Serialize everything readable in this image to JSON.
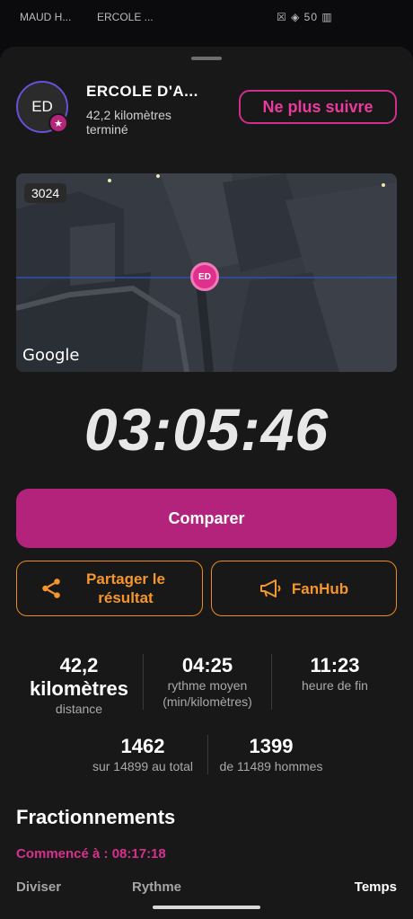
{
  "background": {
    "tab1": "MAUD H...",
    "tab2": "ERCOLE ...",
    "status": "☒ ◈ 50 ▥"
  },
  "header": {
    "avatar_initials": "ED",
    "name": "ERCOLE D'A...",
    "subtitle": "42,2 kilomètres terminé",
    "unfollow_label": "Ne plus suivre"
  },
  "map": {
    "badge": "3024",
    "marker_initials": "ED",
    "logo": "Google"
  },
  "timer": "03:05:46",
  "actions": {
    "compare_label": "Comparer",
    "share_label": "Partager le résultat",
    "fanhub_label": "FanHub"
  },
  "stats": {
    "distance": {
      "value": "42,2 kilomètres",
      "label": "distance"
    },
    "pace": {
      "value": "04:25",
      "label": "rythme moyen (min/kilomètres)"
    },
    "finish": {
      "value": "11:23",
      "label": "heure de fin"
    },
    "overall": {
      "value": "1462",
      "label": "sur 14899 au total"
    },
    "gender": {
      "value": "1399",
      "label": "de 11489 hommes"
    }
  },
  "splits": {
    "title": "Fractionnements",
    "started": "Commencé à : 08:17:18",
    "columns": [
      "Diviser",
      "Rythme",
      "Temps"
    ]
  },
  "colors": {
    "accent_pink": "#b3237c",
    "accent_orange": "#f08a22",
    "sheet_bg": "#181818"
  }
}
